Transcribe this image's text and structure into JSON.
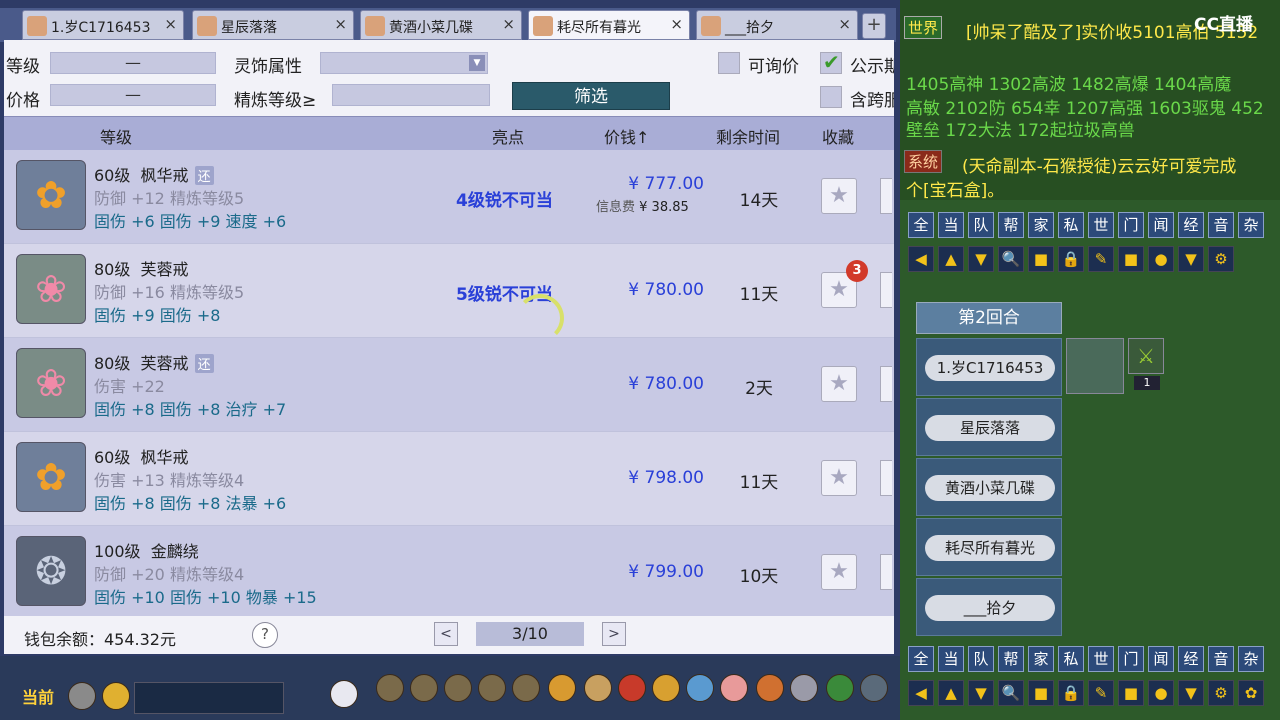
{
  "tabs": [
    {
      "label": "1.岁C1716453",
      "active": false
    },
    {
      "label": "星辰落落",
      "active": false
    },
    {
      "label": "黄酒小菜几碟",
      "active": false
    },
    {
      "label": "耗尽所有暮光",
      "active": true
    },
    {
      "label": "___拾夕",
      "active": false
    }
  ],
  "tab_close": "×",
  "tab_add": "+",
  "filter": {
    "level_label": "等级",
    "level_value": "—",
    "attr_label": "灵饰属性",
    "attr_value": "",
    "price_label": "价格",
    "price_value": "—",
    "refine_label": "精炼等级≥",
    "refine_value": "",
    "inquiry_label": "可询价",
    "inquiry_checked": false,
    "public_label": "公示期",
    "public_checked": true,
    "cross_label": "含跨服",
    "cross_checked": false,
    "filter_button": "筛选"
  },
  "table_headers": {
    "level": "等级",
    "highlight": "亮点",
    "price": "价钱↑",
    "time_left": "剩余时间",
    "favorite": "收藏"
  },
  "rows": [
    {
      "icon": "maple-ring-icon",
      "level": "60级",
      "name": "枫华戒",
      "tag": "还",
      "line2": "防御  +12  精炼等级5",
      "line3": "固伤  +6  固伤  +9  速度  +6",
      "highlight": "4级锐不可当",
      "price": "¥ 777.00",
      "fee_label": "信息费",
      "fee": "¥ 38.85",
      "time": "14天",
      "favorites": ""
    },
    {
      "icon": "lotus-ring-icon",
      "level": "80级",
      "name": "芙蓉戒",
      "tag": "",
      "line2": "防御  +16  精炼等级5",
      "line3": "固伤  +9  固伤  +8",
      "highlight": "5级锐不可当",
      "price": "¥ 780.00",
      "fee_label": "",
      "fee": "",
      "time": "11天",
      "favorites": "3"
    },
    {
      "icon": "lotus-ring-icon",
      "level": "80级",
      "name": "芙蓉戒",
      "tag": "还",
      "line2": "伤害  +22",
      "line3": "固伤  +8  固伤  +8  治疗  +7",
      "highlight": "",
      "price": "¥ 780.00",
      "fee_label": "",
      "fee": "",
      "time": "2天",
      "favorites": ""
    },
    {
      "icon": "maple-ring-icon",
      "level": "60级",
      "name": "枫华戒",
      "tag": "",
      "line2": "伤害  +13  精炼等级4",
      "line3": "固伤  +8  固伤  +8  法暴  +6",
      "highlight": "",
      "price": "¥ 798.00",
      "fee_label": "",
      "fee": "",
      "time": "11天",
      "favorites": ""
    },
    {
      "icon": "qilin-ring-icon",
      "level": "100级",
      "name": "金麟绕",
      "tag": "",
      "line2": "防御  +20  精炼等级4",
      "line3": "固伤  +10  固伤  +10  物暴  +15",
      "highlight": "",
      "price": "¥ 799.00",
      "fee_label": "",
      "fee": "",
      "time": "10天",
      "favorites": ""
    }
  ],
  "footer": {
    "wallet": "钱包余额：454.32元",
    "help": "?",
    "prev": "<",
    "next": ">",
    "page": "3/10"
  },
  "bottombar": {
    "current_label": "当前"
  },
  "right": {
    "cc_logo": "CC直播",
    "world_tag": "世界",
    "chat1": "[帅呆了酷及了]实价收5101高伯  5152",
    "chat2": "1405高神  1302高波  1482高爆  1404高魔",
    "chat3": "高敏  2102防  654幸  1207高强  1603驱鬼  452",
    "chat4": "壁垒  172大法  172起垃圾高兽",
    "system_tag": "系统",
    "chat5": "(天命副本-石猴授徒)云云好可爱完成",
    "chat6": "个[宝石盒]。",
    "channels": [
      "全",
      "当",
      "队",
      "帮",
      "家",
      "私",
      "世",
      "门",
      "闻",
      "经",
      "音",
      "杂"
    ],
    "tools": [
      "◀",
      "▲",
      "▼",
      "🔍",
      "■",
      "🔒",
      "✎",
      "■",
      "●",
      "▼",
      "⚙"
    ],
    "tools2": [
      "◀",
      "▲",
      "▼",
      "🔍",
      "■",
      "🔒",
      "✎",
      "■",
      "●",
      "▼",
      "⚙",
      "✿"
    ],
    "round": "第2回合",
    "players": [
      "1.岁C1716453",
      "星辰落落",
      "黄酒小菜几碟",
      "耗尽所有暮光",
      "___拾夕"
    ],
    "weapon_count": "1"
  },
  "colors": {
    "accent_blue": "#2a40d8",
    "filter_button": "#2a5a6a",
    "badge_red": "#d23a2a"
  }
}
